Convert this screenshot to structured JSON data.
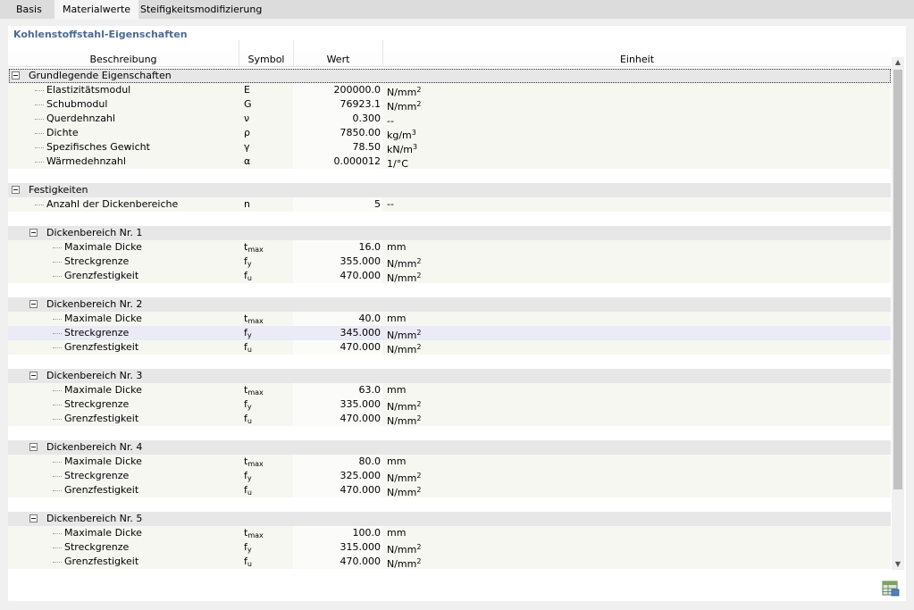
{
  "tabs": [
    "Basis",
    "Materialwerte",
    "Steifigkeitsmodifizierung"
  ],
  "panel_title": "Kohlenstoffstahl-Eigenschaften",
  "columns": {
    "beschreibung": "Beschreibung",
    "symbol": "Symbol",
    "wert": "Wert",
    "einheit": "Einheit"
  },
  "groups": {
    "grundlegende": {
      "label": "Grundlegende Eigenschaften",
      "rows": [
        {
          "desc": "Elastizitätsmodul",
          "sym": "E",
          "val": "200000.0",
          "unit": "N/mm",
          "unit_sup": "2"
        },
        {
          "desc": "Schubmodul",
          "sym": "G",
          "val": "76923.1",
          "unit": "N/mm",
          "unit_sup": "2"
        },
        {
          "desc": "Querdehnzahl",
          "sym": "ν",
          "val": "0.300",
          "unit": "--",
          "unit_sup": ""
        },
        {
          "desc": "Dichte",
          "sym": "ρ",
          "val": "7850.00",
          "unit": "kg/m",
          "unit_sup": "3"
        },
        {
          "desc": "Spezifisches Gewicht",
          "sym": "γ",
          "val": "78.50",
          "unit": "kN/m",
          "unit_sup": "3"
        },
        {
          "desc": "Wärmedehnzahl",
          "sym": "α",
          "val": "0.000012",
          "unit": "1/°C",
          "unit_sup": ""
        }
      ]
    },
    "festigkeiten": {
      "label": "Festigkeiten",
      "anzahl": {
        "desc": "Anzahl der Dickenbereiche",
        "sym": "n",
        "val": "5",
        "unit": "--"
      },
      "bereiche": [
        {
          "label": "Dickenbereich Nr. 1",
          "tmax": "16.0",
          "fy": "355.000",
          "fu": "470.000"
        },
        {
          "label": "Dickenbereich Nr. 2",
          "tmax": "40.0",
          "fy": "345.000",
          "fu": "470.000"
        },
        {
          "label": "Dickenbereich Nr. 3",
          "tmax": "63.0",
          "fy": "335.000",
          "fu": "470.000"
        },
        {
          "label": "Dickenbereich Nr. 4",
          "tmax": "80.0",
          "fy": "325.000",
          "fu": "470.000"
        },
        {
          "label": "Dickenbereich Nr. 5",
          "tmax": "100.0",
          "fy": "315.000",
          "fu": "470.000"
        }
      ]
    }
  },
  "labels": {
    "max_dicke": "Maximale Dicke",
    "streckgrenze": "Streckgrenze",
    "grenzfestigkeit": "Grenzfestigkeit",
    "t": "t",
    "t_sub": "max",
    "f": "f",
    "fy_sub": "y",
    "fu_sub": "u",
    "mm": "mm",
    "nmm": "N/mm",
    "nmm_sup": "2"
  },
  "selected_row": "Dickenbereich Nr. 2 / Streckgrenze",
  "colors": {
    "title": "#4b6a95",
    "group_bg": "#e7e7e7",
    "item_bg": "#f7f7f2",
    "selected_bg": "#ebebf7"
  }
}
